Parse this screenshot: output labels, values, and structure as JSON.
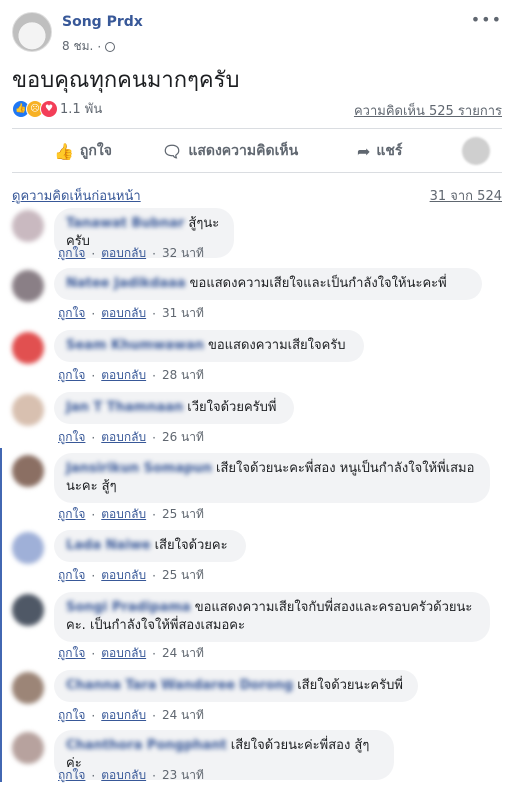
{
  "post": {
    "author": "Song Prdx",
    "time": "8 ชม.",
    "text": "ขอบคุณทุกคนมากๆครับ",
    "reaction_count": "1.1 พัน",
    "comment_count": "ความคิดเห็น 525 รายการ"
  },
  "actions": {
    "like": "ถูกใจ",
    "comment": "แสดงความคิดเห็น",
    "share": "แชร์"
  },
  "comments_header": {
    "prev_link": "ดูความคิดเห็นก่อนหน้า",
    "page_count": "31 จาก 524"
  },
  "comment_actions": {
    "like": "ถูกใจ",
    "reply": "ตอบกลับ"
  },
  "comments": [
    {
      "name": "Tanawat Bubnar",
      "text": "สู้ๆนะครับ",
      "time": "32 นาที"
    },
    {
      "name": "Natee Jadikdaaa",
      "text": "ขอแสดงความเสียใจและเป็นกำลังใจให้นะคะพี่",
      "time": "31 นาที"
    },
    {
      "name": "Seam Khumwawan",
      "text": "ขอแสดงความเสียใจครับ",
      "time": "28 นาที"
    },
    {
      "name": "Jan T Thamnaan",
      "text": "เวียใจด้วยครับพี่",
      "time": "26 นาที"
    },
    {
      "name": "Jansirikun Somapun",
      "text": "เสียใจด้วยนะคะพี่สอง หนูเป็นกำลังใจให้พี่เสมอนะคะ สู้ๆ",
      "time": "25 นาที"
    },
    {
      "name": "Lada Naiwe",
      "text": "เสียใจด้วยคะ",
      "time": "25 นาที"
    },
    {
      "name": "Songi Pradipama",
      "text": "ขอแสดงความเสียใจกับพี่สองและครอบครัวด้วยนะคะ. เป็นกำลังใจให้พี่สองเสมอคะ",
      "time": "24 นาที"
    },
    {
      "name": "Channa Tara Wandaree Dorong",
      "text": "เสียใจด้วยนะครับพี่",
      "time": "24 นาที"
    },
    {
      "name": "Chanthora Pongphant",
      "text": "เสียใจด้วยนะค่ะพี่สอง สู้ๆค่ะ",
      "time": "23 นาที"
    }
  ],
  "colors": {
    "link": "#385898",
    "bubble": "#f2f3f5",
    "like": "#2078f4",
    "love": "#f33e58",
    "sad": "#f7b125"
  },
  "icons": [
    "more-icon",
    "globe-icon",
    "like-reaction-icon",
    "sad-reaction-icon",
    "love-reaction-icon",
    "thumbs-up-icon",
    "comment-icon",
    "share-icon"
  ]
}
